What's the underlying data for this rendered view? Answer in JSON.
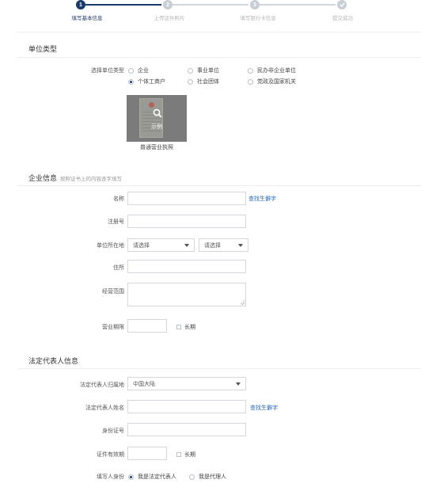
{
  "stepper": {
    "steps": [
      {
        "number": "1",
        "label": "填写基本信息",
        "state": "active"
      },
      {
        "number": "2",
        "label": "上传证件照片",
        "state": "pending"
      },
      {
        "number": "3",
        "label": "填写银行卡信息",
        "state": "pending"
      },
      {
        "number": "",
        "label": "提交成功",
        "state": "pending"
      }
    ]
  },
  "unit_type": {
    "title": "单位类型",
    "field_label": "选择单位类型",
    "options": [
      {
        "label": "企业",
        "checked": false
      },
      {
        "label": "事业单位",
        "checked": false
      },
      {
        "label": "民办非企业单位",
        "checked": false
      },
      {
        "label": "个体工商户",
        "checked": true
      },
      {
        "label": "社会团体",
        "checked": false
      },
      {
        "label": "党政及国家机关",
        "checked": false
      }
    ],
    "example": {
      "overlay_label": "示例",
      "caption": "普通营业执照"
    }
  },
  "company": {
    "title": "企业信息",
    "subtitle": "按照证书上的内容逐字填写",
    "name_label": "名称",
    "name_value": "",
    "find_link": "查找生僻字",
    "reg_no_label": "注册号",
    "reg_no_value": "",
    "location_label": "单位所在地",
    "province_placeholder": "请选择",
    "city_placeholder": "请选择",
    "address_label": "住所",
    "address_value": "",
    "scope_label": "经营范围",
    "term_label": "营业期限",
    "long_term_label": "长期"
  },
  "legal": {
    "title": "法定代表人信息",
    "region_label": "法定代表人归属地",
    "region_value": "中国大陆",
    "name_label": "法定代表人姓名",
    "find_link": "查找生僻字",
    "id_label": "身份证号",
    "valid_label": "证件有效期",
    "long_term_label": "长期",
    "identity_label": "填写人身份",
    "identity_options": [
      {
        "label": "我是法定代表人",
        "checked": true
      },
      {
        "label": "我是代理人",
        "checked": false
      }
    ]
  },
  "colors": {
    "accent": "#1a3a6c",
    "link": "#2b6cb8",
    "pending": "#c8ced6"
  }
}
